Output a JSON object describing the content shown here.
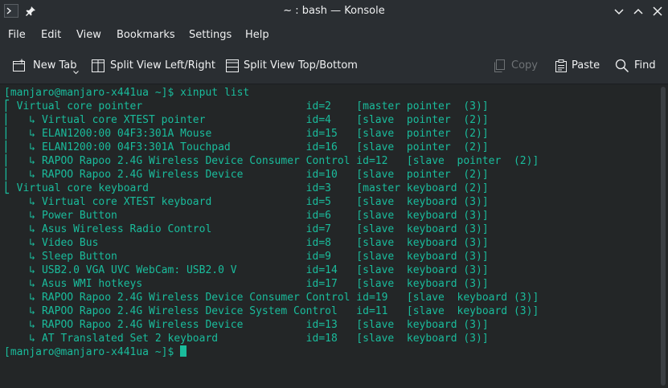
{
  "window": {
    "title": "~ : bash — Konsole"
  },
  "menubar": {
    "items": [
      "File",
      "Edit",
      "View",
      "Bookmarks",
      "Settings",
      "Help"
    ]
  },
  "toolbar": {
    "new_tab": "New Tab",
    "split_lr": "Split View Left/Right",
    "split_tb": "Split View Top/Bottom",
    "copy": "Copy",
    "paste": "Paste",
    "find": "Find"
  },
  "terminal": {
    "prompt": "[manjaro@manjaro-x441ua ~]$",
    "command": " xinput list",
    "output": [
      "⎡ Virtual core pointer                    \tid=2\t[master pointer  (3)]",
      "⎜   ↳ Virtual core XTEST pointer              \tid=4\t[slave  pointer  (2)]",
      "⎜   ↳ ELAN1200:00 04F3:301A Mouse             \tid=15\t[slave  pointer  (2)]",
      "⎜   ↳ ELAN1200:00 04F3:301A Touchpad          \tid=16\t[slave  pointer  (2)]",
      "⎜   ↳ RAPOO Rapoo 2.4G Wireless Device Consumer Control\tid=12\t[slave  pointer  (2)]",
      "⎜   ↳ RAPOO Rapoo 2.4G Wireless Device        \tid=10\t[slave  pointer  (2)]",
      "⎣ Virtual core keyboard                   \tid=3\t[master keyboard (2)]",
      "    ↳ Virtual core XTEST keyboard             \tid=5\t[slave  keyboard (3)]",
      "    ↳ Power Button                            \tid=6\t[slave  keyboard (3)]",
      "    ↳ Asus Wireless Radio Control             \tid=7\t[slave  keyboard (3)]",
      "    ↳ Video Bus                               \tid=8\t[slave  keyboard (3)]",
      "    ↳ Sleep Button                            \tid=9\t[slave  keyboard (3)]",
      "    ↳ USB2.0 VGA UVC WebCam: USB2.0 V         \tid=14\t[slave  keyboard (3)]",
      "    ↳ Asus WMI hotkeys                        \tid=17\t[slave  keyboard (3)]",
      "    ↳ RAPOO Rapoo 2.4G Wireless Device Consumer Control\tid=19\t[slave  keyboard (3)]",
      "    ↳ RAPOO Rapoo 2.4G Wireless Device System Control\tid=11\t[slave  keyboard (3)]",
      "    ↳ RAPOO Rapoo 2.4G Wireless Device        \tid=13\t[slave  keyboard (3)]",
      "    ↳ AT Translated Set 2 keyboard            \tid=18\t[slave  keyboard (3)]"
    ],
    "final_prompt": "[manjaro@manjaro-x441ua ~]$ "
  },
  "colors": {
    "terminal_fg": "#1abc9c",
    "terminal_bg": "#232627",
    "chrome_bg": "#2a2e32"
  }
}
